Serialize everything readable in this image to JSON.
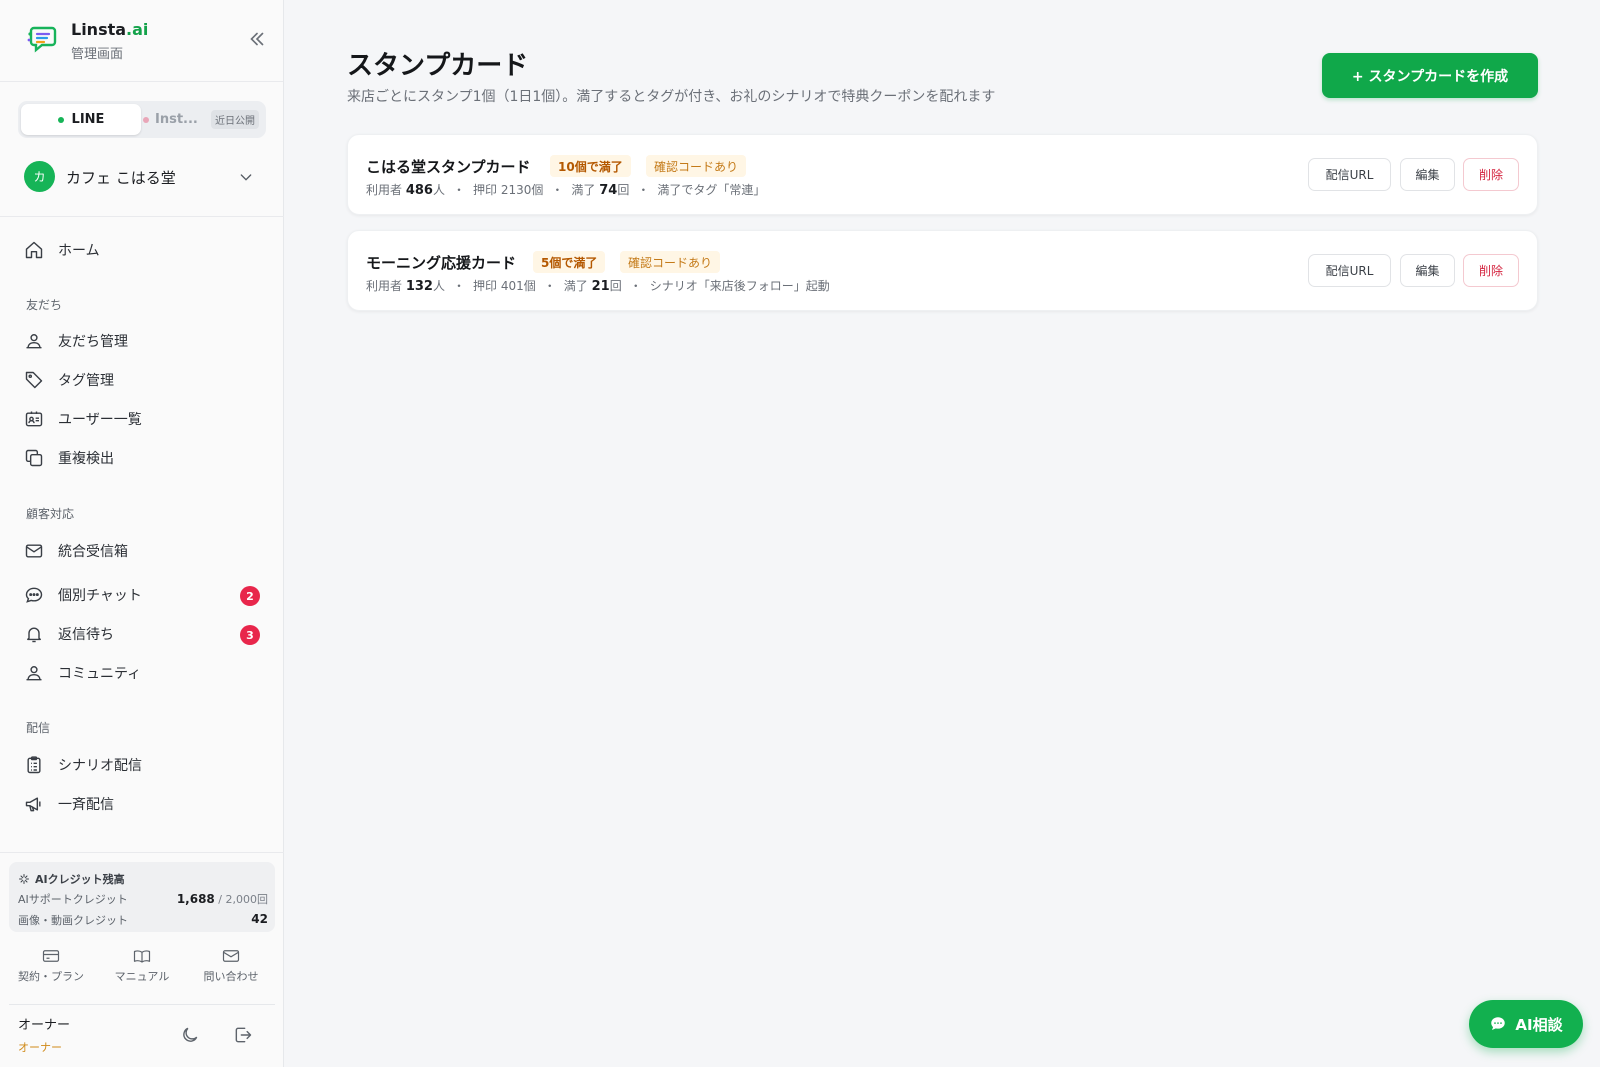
{
  "brand": {
    "name": "Linsta",
    "name_suffix": ".ai",
    "subtitle": "管理画面"
  },
  "channels": {
    "line_label": "LINE",
    "insta_label": "Inst...",
    "insta_badge": "近日公開"
  },
  "shop": {
    "avatar": "カ",
    "name": "カフェ こはる堂"
  },
  "nav": {
    "home": "ホーム",
    "section_friends": "友だち",
    "friends_manage": "友だち管理",
    "tags_manage": "タグ管理",
    "users_list": "ユーザー一覧",
    "duplicates": "重複検出",
    "section_support": "顧客対応",
    "inbox": "統合受信箱",
    "chat": "個別チャット",
    "chat_badge": "2",
    "awaiting": "返信待ち",
    "awaiting_badge": "3",
    "community": "コミュニティ",
    "section_delivery": "配信",
    "scenario": "シナリオ配信",
    "broadcast": "一斉配信"
  },
  "credits": {
    "title": "AIクレジット残高",
    "support_label": "AIサポートクレジット",
    "support_value": "1,688",
    "support_total": "/ 2,000回",
    "media_label": "画像・動画クレジット",
    "media_value": "42"
  },
  "footer": {
    "plan": "契約・プラン",
    "manual": "マニュアル",
    "contact": "問い合わせ"
  },
  "user": {
    "name": "オーナー",
    "role": "オーナー"
  },
  "page": {
    "title": "スタンプカード",
    "description": "来店ごとにスタンプ1個（1日1個）。満了するとタグが付き、お礼のシナリオで特典クーポンを配れます",
    "create_button": "+ スタンプカードを作成"
  },
  "cards": [
    {
      "title": "こはる堂スタンプカード",
      "tag_complete": "10個で満了",
      "tag_code": "確認コードあり",
      "users_label": "利用者",
      "users_value": "486",
      "users_unit": "人",
      "stamps": "押印 2130個",
      "complete_label": "満了",
      "complete_value": "74",
      "complete_unit": "回",
      "action": "満了でタグ「常連」",
      "btn_url": "配信URL",
      "btn_edit": "編集",
      "btn_delete": "削除"
    },
    {
      "title": "モーニング応援カード",
      "tag_complete": "5個で満了",
      "tag_code": "確認コードあり",
      "users_label": "利用者",
      "users_value": "132",
      "users_unit": "人",
      "stamps": "押印 401個",
      "complete_label": "満了",
      "complete_value": "21",
      "complete_unit": "回",
      "action": "シナリオ「来店後フォロー」起動",
      "btn_url": "配信URL",
      "btn_edit": "編集",
      "btn_delete": "削除"
    }
  ],
  "ai_fab": {
    "label": "AI相談"
  },
  "colors": {
    "accent": "#10a84a",
    "danger": "#d4243f",
    "tag_bg": "#fff6e5",
    "badge": "#e8264b"
  }
}
